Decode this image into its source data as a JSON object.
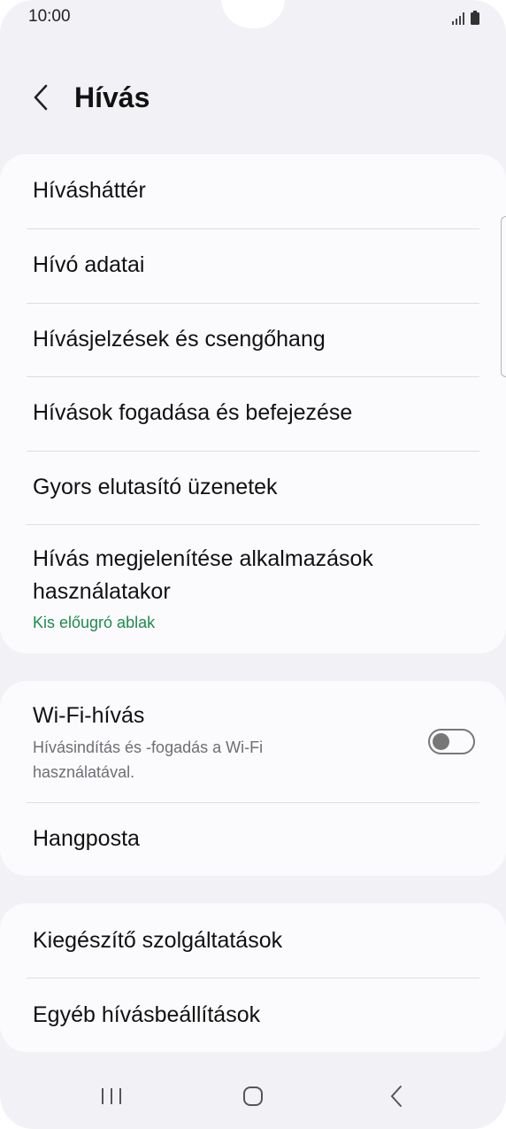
{
  "status_bar": {
    "time": "10:00",
    "icons": [
      "signal-icon",
      "battery-icon"
    ]
  },
  "header": {
    "back_icon": "chevron-left-icon",
    "title": "Hívás"
  },
  "groups": [
    {
      "items": [
        {
          "label": "Hívásháttér"
        },
        {
          "label": "Hívó adatai"
        },
        {
          "label": "Hívásjelzések és csengőhang"
        },
        {
          "label": "Hívások fogadása és befejezése"
        },
        {
          "label": "Gyors elutasító üzenetek"
        },
        {
          "label_line1": "Hívás megjelenítése alkalmazások",
          "label_line2": "használatakor",
          "sublabel": "Kis előugró ablak"
        }
      ]
    },
    {
      "items": [
        {
          "label": "Wi-Fi-hívás",
          "sub_line1": "Hívásindítás és -fogadás a Wi-Fi",
          "sub_line2": "használatával.",
          "toggle_on": false
        },
        {
          "label": "Hangposta"
        }
      ]
    },
    {
      "items": [
        {
          "label": "Kiegészítő szolgáltatások"
        },
        {
          "label": "Egyéb hívásbeállítások"
        }
      ]
    }
  ],
  "navbar": {
    "icons": [
      "recent-apps-icon",
      "home-icon",
      "back-icon"
    ]
  },
  "colors": {
    "background": "#f2f1f6",
    "card": "#fbfbfe",
    "accent_green": "#1f8a4c",
    "secondary_text": "#6e6e73"
  }
}
